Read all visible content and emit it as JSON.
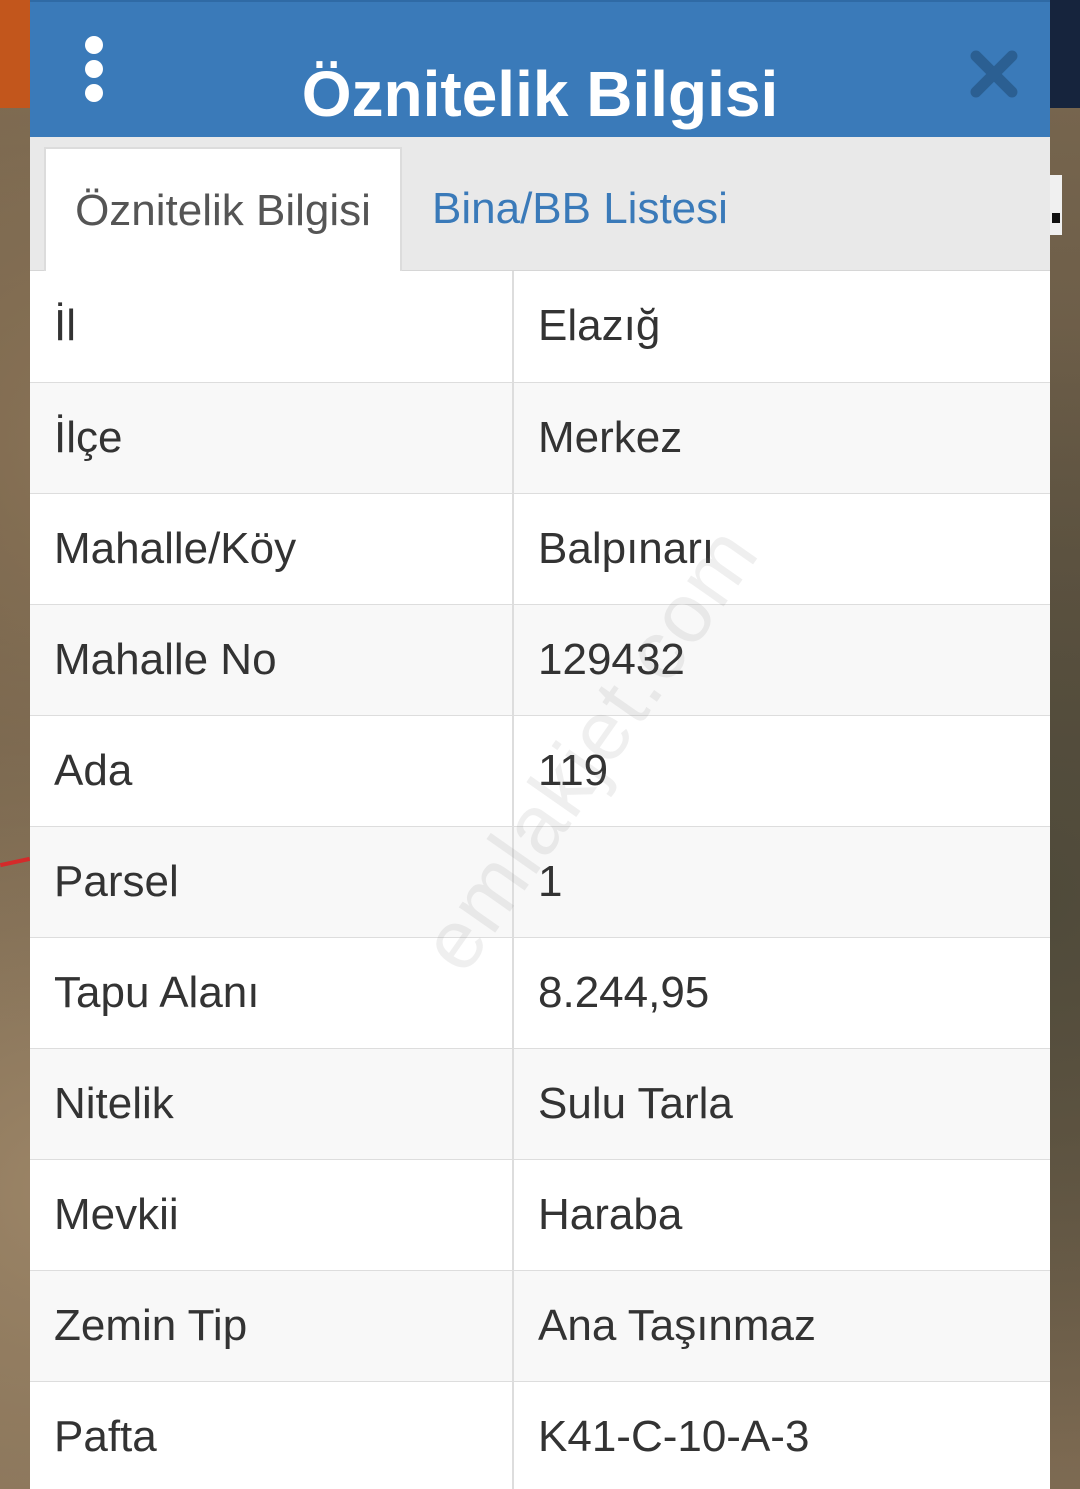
{
  "header": {
    "title": "Öznitelik Bilgisi"
  },
  "tabs": [
    {
      "label": "Öznitelik Bilgisi",
      "active": true
    },
    {
      "label": "Bina/BB Listesi",
      "active": false
    }
  ],
  "attributes": [
    {
      "key": "İl",
      "value": "Elazığ"
    },
    {
      "key": "İlçe",
      "value": "Merkez"
    },
    {
      "key": "Mahalle/Köy",
      "value": "Balpınarı"
    },
    {
      "key": "Mahalle No",
      "value": "129432"
    },
    {
      "key": "Ada",
      "value": "119"
    },
    {
      "key": "Parsel",
      "value": "1"
    },
    {
      "key": "Tapu Alanı",
      "value": "8.244,95"
    },
    {
      "key": "Nitelik",
      "value": "Sulu Tarla"
    },
    {
      "key": "Mevkii",
      "value": "Haraba"
    },
    {
      "key": "Zemin Tip",
      "value": "Ana Taşınmaz"
    },
    {
      "key": "Pafta",
      "value": "K41-C-10-A-3"
    }
  ],
  "watermark": "emlakjet.com",
  "colors": {
    "header_bg": "#3a7ab9",
    "tab_link": "#3a7ab9"
  },
  "icons": {
    "menu": "vertical-dots-icon",
    "close": "close-icon"
  }
}
